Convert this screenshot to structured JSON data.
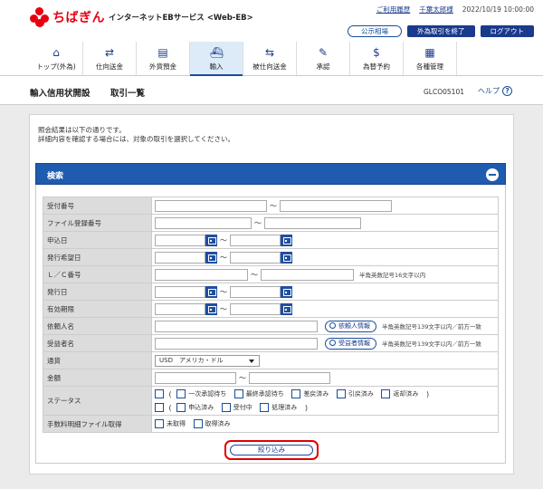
{
  "header": {
    "bank_name": "ちばぎん",
    "service_name": "インターネットEBサービス <Web-EB>",
    "usage_history_link": "ご利用履歴",
    "user_name": "千葉太郎様",
    "timestamp": "2022/10/19 10:00:00",
    "public_rate_button": "公示相場",
    "end_fx_button": "外為取引を終了",
    "logout_button": "ログアウト"
  },
  "nav": {
    "items": [
      {
        "label": "トップ(外為)",
        "icon": "home-icon"
      },
      {
        "label": "仕向送金",
        "icon": "remittance-icon"
      },
      {
        "label": "外貨預金",
        "icon": "deposit-icon"
      },
      {
        "label": "輸入",
        "icon": "import-icon",
        "active": true
      },
      {
        "label": "被仕向送金",
        "icon": "incoming-remittance-icon"
      },
      {
        "label": "承認",
        "icon": "approval-icon"
      },
      {
        "label": "為替予約",
        "icon": "fx-contract-icon"
      },
      {
        "label": "各種管理",
        "icon": "management-icon"
      }
    ]
  },
  "page": {
    "title": "輸入信用状開設",
    "subtitle": "取引一覧",
    "screen_id": "GLCO05101",
    "help_label": "ヘルプ"
  },
  "message": {
    "line1": "照会結果は以下の通りです。",
    "line2": "詳細内容を確認する場合には、対象の取引を選択してください。"
  },
  "search": {
    "title": "検索",
    "tilde": "～",
    "fields": {
      "receipt_no": "受付番号",
      "file_reg_no": "ファイル登録番号",
      "apply_date": "申込日",
      "desired_issue_date": "発行希望日",
      "lc_no": "Ｌ／Ｃ番号",
      "issue_date": "発行日",
      "expiry_date": "有効期限",
      "requester_name": "依頼人名",
      "beneficiary_name": "受益者名",
      "currency": "通貨",
      "amount": "金額",
      "status": "ステータス",
      "fee_file": "手数料明細ファイル取得"
    },
    "notes": {
      "lc_no": "半角英数記号16文字以内",
      "requester": "半角英数記号139文字以内／前方一致",
      "beneficiary": "半角英数記号139文字以内／前方一致"
    },
    "lookup_requester": "依頼人情報",
    "lookup_beneficiary": "受益者情報",
    "currency_value": "USD　アメリカ・ドル",
    "status_options_row1": [
      "一次承認待ち",
      "最終承認待ち",
      "差戻済み",
      "引戻済み",
      "返却済み"
    ],
    "status_options_row2": [
      "申込済み",
      "受付中",
      "処理済み"
    ],
    "fee_options": [
      "未取得",
      "取得済み"
    ],
    "search_button": "絞り込み"
  }
}
